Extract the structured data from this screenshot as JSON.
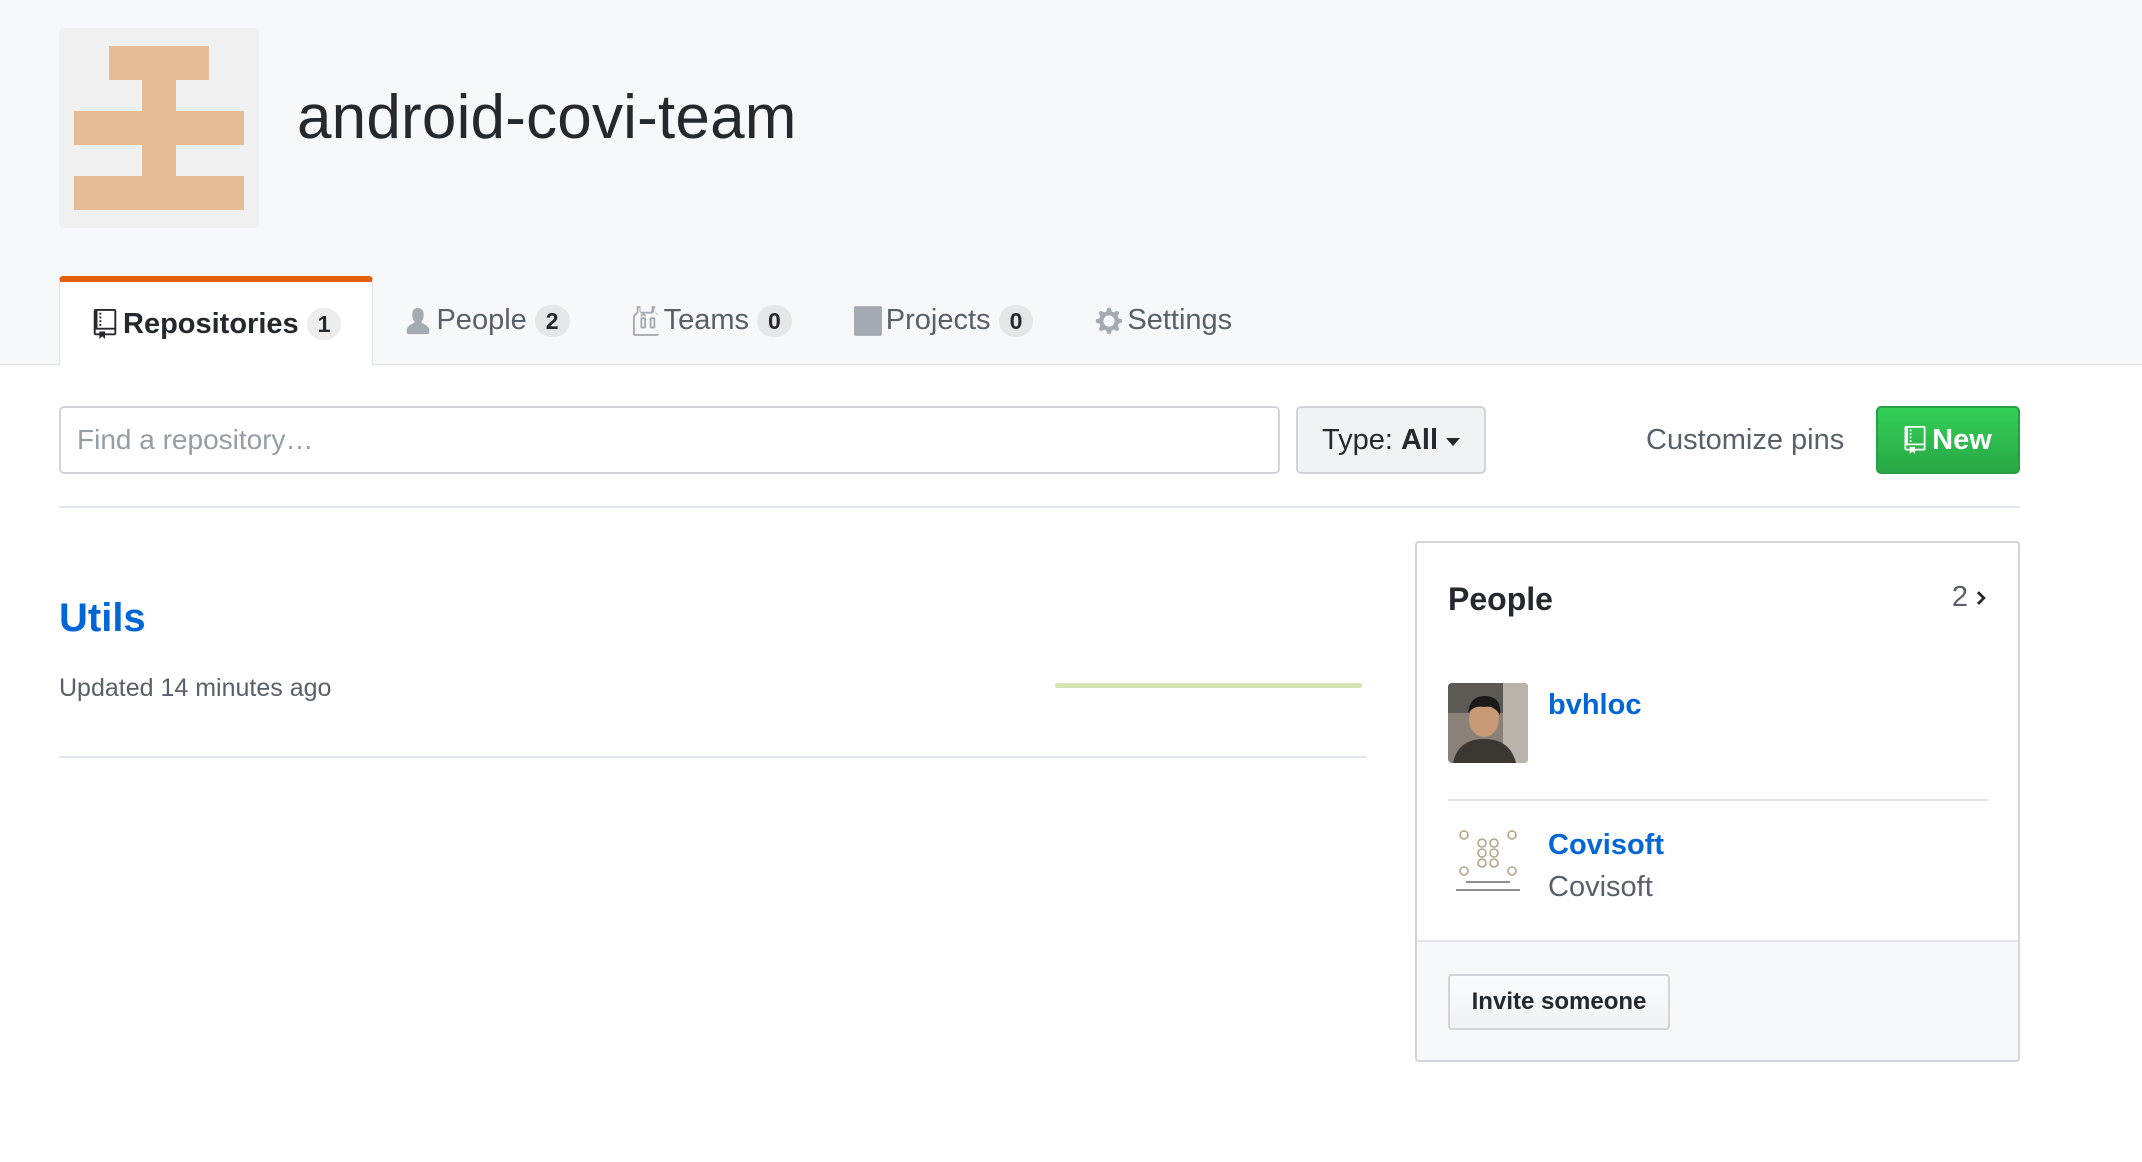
{
  "org": {
    "name": "android-covi-team",
    "avatar_color": "#e6bc96"
  },
  "tabs": [
    {
      "label": "Repositories",
      "count": "1",
      "icon": "repo-icon",
      "selected": true
    },
    {
      "label": "People",
      "count": "2",
      "icon": "person-icon"
    },
    {
      "label": "Teams",
      "count": "0",
      "icon": "jersey-icon"
    },
    {
      "label": "Projects",
      "count": "0",
      "icon": "project-icon"
    },
    {
      "label": "Settings",
      "icon": "gear-icon"
    }
  ],
  "filter": {
    "search_placeholder": "Find a repository…",
    "type_label": "Type:",
    "type_value": "All",
    "customize_label": "Customize pins",
    "new_label": "New"
  },
  "repos": [
    {
      "name": "Utils",
      "updated": "Updated 14 minutes ago"
    }
  ],
  "people": {
    "title": "People",
    "count": "2",
    "members": [
      {
        "login": "bvhloc",
        "fullname": ""
      },
      {
        "login": "Covisoft",
        "fullname": "Covisoft"
      }
    ],
    "invite_label": "Invite someone"
  },
  "colors": {
    "accent_tab": "#e36209",
    "link": "#0366d6",
    "new_button": "#28a745"
  }
}
